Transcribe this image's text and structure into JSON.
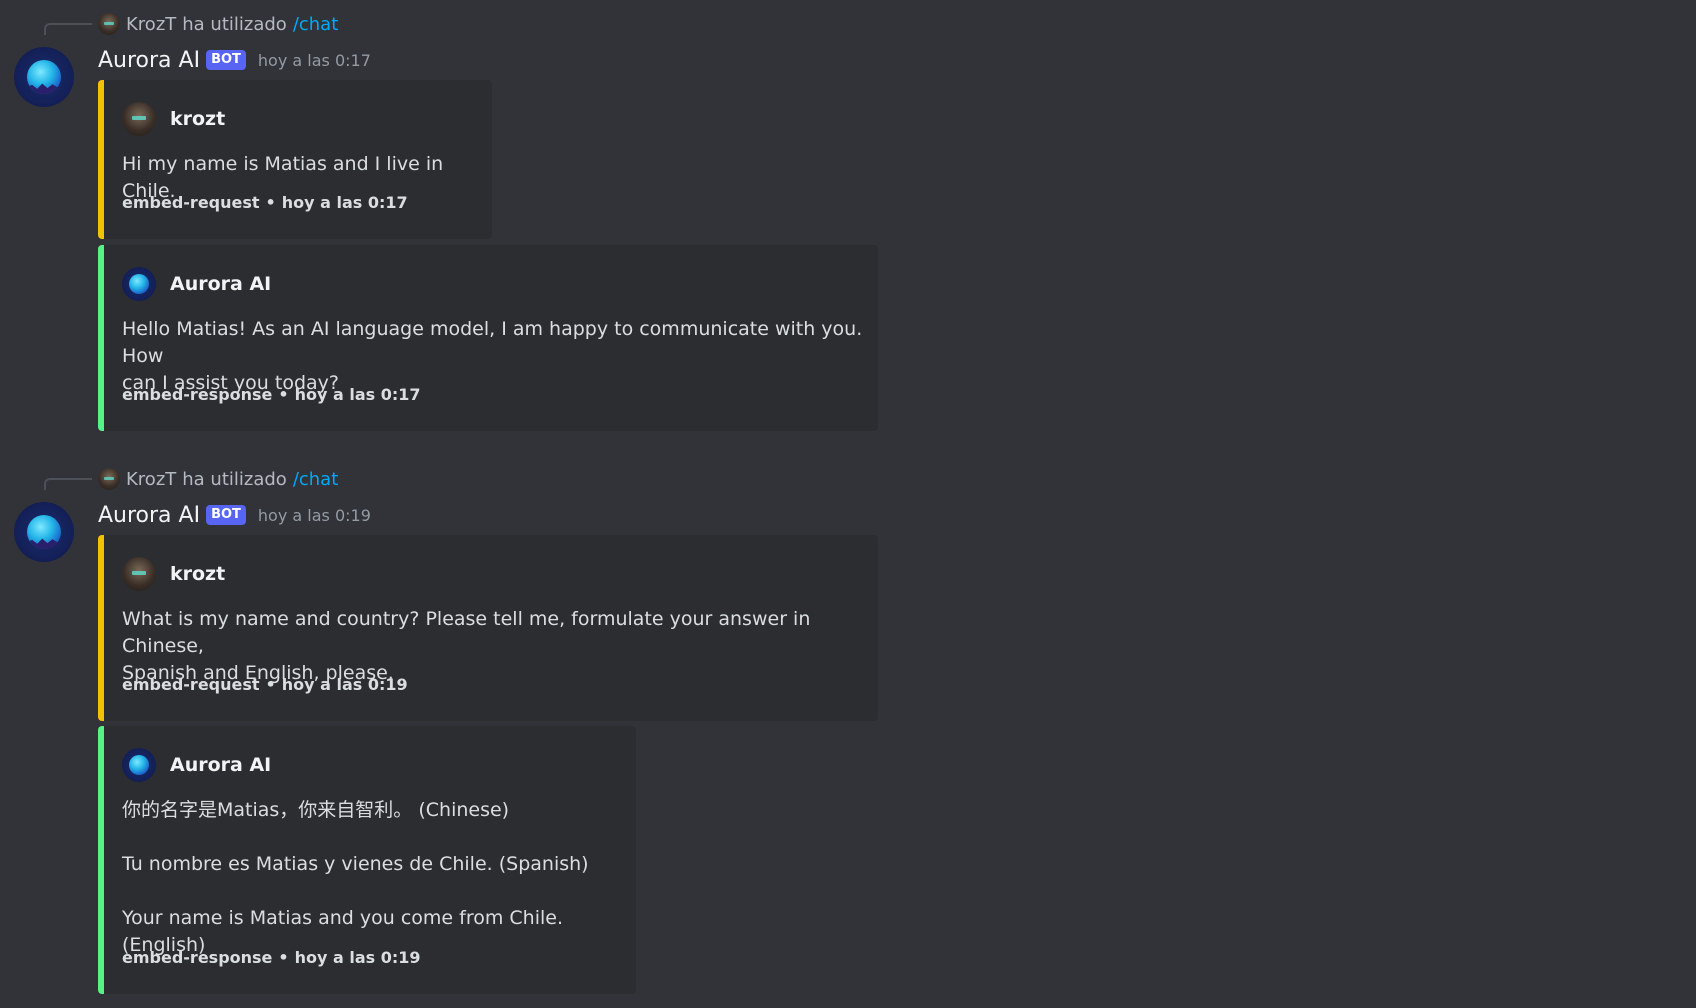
{
  "messages": [
    {
      "reply": {
        "user": "KrozT",
        "action": "ha utilizado",
        "command": "/chat"
      },
      "author": "Aurora AI",
      "bot_tag": "BOT",
      "timestamp": "hoy a las 0:17",
      "embeds": [
        {
          "color": "#f0c300",
          "author": "krozt",
          "description": "Hi my name is Matias and I live in Chile.",
          "footer_text": "embed-request",
          "footer_time": "hoy a las 0:17"
        },
        {
          "color": "#57f287",
          "author": "Aurora AI",
          "description": "Hello Matias! As an AI language model, I am happy to communicate with you. How\ncan I assist you today?",
          "footer_text": "embed-response",
          "footer_time": "hoy a las 0:17"
        }
      ]
    },
    {
      "reply": {
        "user": "KrozT",
        "action": "ha utilizado",
        "command": "/chat"
      },
      "author": "Aurora AI",
      "bot_tag": "BOT",
      "timestamp": "hoy a las 0:19",
      "embeds": [
        {
          "color": "#f0c300",
          "author": "krozt",
          "description": "What is my name and country? Please tell me, formulate your answer in Chinese,\nSpanish and English, please.",
          "footer_text": "embed-request",
          "footer_time": "hoy a las 0:19"
        },
        {
          "color": "#57f287",
          "author": "Aurora AI",
          "description": "你的名字是Matias，你来自智利。 (Chinese)\n\nTu nombre es Matias y vienes de Chile. (Spanish)\n\nYour name is Matias and you come from Chile. (English)",
          "footer_text": "embed-response",
          "footer_time": "hoy a las 0:19"
        }
      ]
    }
  ]
}
